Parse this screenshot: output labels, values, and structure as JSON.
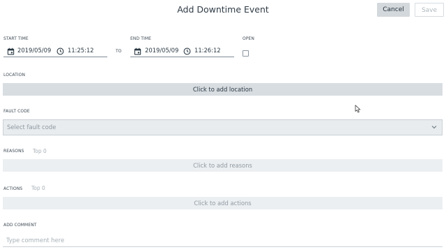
{
  "header": {
    "title": "Add Downtime Event",
    "cancel_label": "Cancel",
    "save_label": "Save"
  },
  "start_time": {
    "label": "START TIME",
    "date": "2019/05/09",
    "time": "11:25:12"
  },
  "to_label": "TO",
  "end_time": {
    "label": "END TIME",
    "date": "2019/05/09",
    "time": "11:26:12"
  },
  "open": {
    "label": "OPEN",
    "checked": false
  },
  "location": {
    "label": "LOCATION",
    "button_text": "Click to add location"
  },
  "fault_code": {
    "label": "FAULT CODE",
    "placeholder": "Select fault code"
  },
  "reasons": {
    "label": "REASONS",
    "top": "Top 0",
    "button_text": "Click to add reasons"
  },
  "actions": {
    "label": "ACTIONS",
    "top": "Top 0",
    "button_text": "Click to add actions"
  },
  "comment": {
    "label": "ADD COMMENT",
    "placeholder": "Type comment here"
  },
  "colors": {
    "primary_button": "#d3d8dc",
    "location_bar": "#d8dde1",
    "muted_bar": "#eceff1",
    "text": "#2c3a45",
    "muted_text": "#8f9aa3"
  },
  "icons": {
    "date": "calendar-icon",
    "time": "clock-icon",
    "select": "chevron-down-icon"
  }
}
